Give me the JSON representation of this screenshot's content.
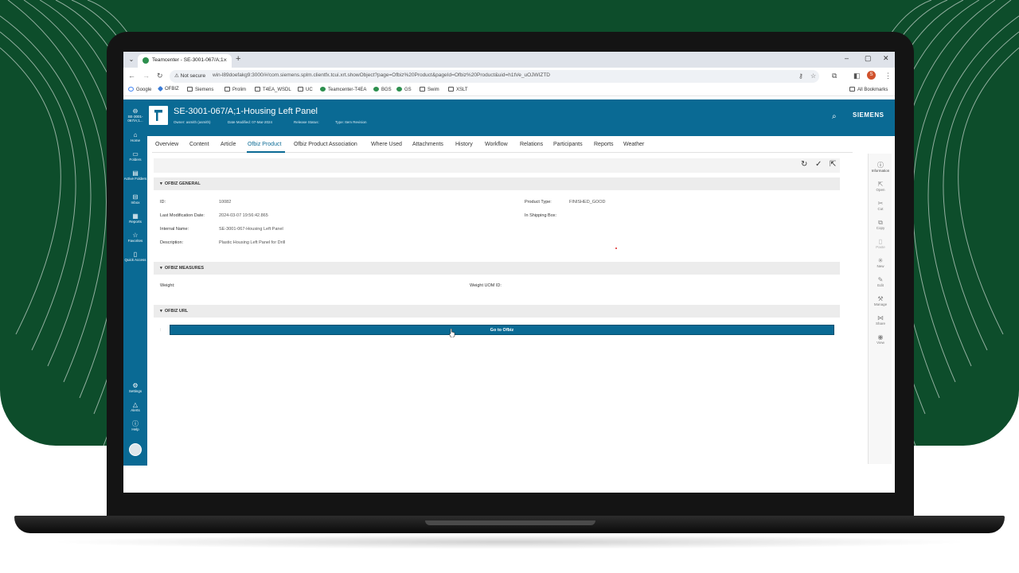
{
  "browser": {
    "tab_title": "Teamcenter - SE-3001-067/A;1",
    "tab_close": "×",
    "new_tab": "+",
    "window_controls": [
      "–",
      "▢",
      "✕"
    ],
    "not_secure": "⚠ Not secure",
    "url": "win-l89doefakg9:3000/#/com.siemens.splm.clientfx.tcui.xrt.showObject?page=Ofbiz%20Product&pageId=Ofbiz%20Product&uid=h1tVe_uOJWIZTD",
    "profile_initial": "S",
    "bookmarks": [
      "Google",
      "OFBIZ",
      "Siemens",
      "Prolim",
      "T4EA_WSDL",
      "UC",
      "Teamcenter-T4EA",
      "BGS",
      "GS",
      "Swim",
      "XSLT"
    ],
    "all_bookmarks": "All Bookmarks"
  },
  "leftnav": {
    "items": [
      {
        "label": "SE-3001-067/A;1...",
        "icon": "back-icon"
      },
      {
        "label": "Home",
        "icon": "home-icon"
      },
      {
        "label": "Folders",
        "icon": "folder-icon"
      },
      {
        "label": "Active Folders",
        "icon": "active-folders-icon"
      },
      {
        "label": "Inbox",
        "icon": "inbox-icon"
      },
      {
        "label": "Reports",
        "icon": "reports-icon"
      },
      {
        "label": "Favorites",
        "icon": "star-icon"
      },
      {
        "label": "Quick Access",
        "icon": "quick-access-icon"
      },
      {
        "label": "Settings",
        "icon": "gear-icon"
      },
      {
        "label": "Alerts",
        "icon": "bell-icon"
      },
      {
        "label": "Help",
        "icon": "help-icon"
      }
    ]
  },
  "header": {
    "title": "SE-3001-067/A;1-Housing Left Panel",
    "owner": "Owner: asmith (asmith)",
    "date_modified": "Date Modified: 07-Mar-2024",
    "release_status": "Release Status:",
    "type": "Type: Item Revision",
    "brand": "SIEMENS"
  },
  "tabs": [
    "Overview",
    "Content",
    "Article",
    "Ofbiz Product",
    "Ofbiz Product Association",
    "Where Used",
    "Attachments",
    "History",
    "Workflow",
    "Relations",
    "Participants",
    "Reports",
    "Weather"
  ],
  "active_tab": "Ofbiz Product",
  "sections": {
    "general": {
      "title": "OFBIZ GENERAL",
      "id_label": "ID:",
      "id_value": "10082",
      "last_mod_label": "Last Modification Date:",
      "last_mod_value": "2024-03-07 19:56:42.865",
      "internal_name_label": "Internal Name:",
      "internal_name_value": "SE-3001-067-Housing Left Panel",
      "description_label": "Description:",
      "description_value": "Plastic Housing Left Panel for Drill",
      "product_type_label": "Product Type:",
      "product_type_value": "FINISHED_GOOD",
      "in_shipping_box_label": "In Shipping Box:"
    },
    "measures": {
      "title": "OFBIZ MEASURES",
      "weight_label": "Weight:",
      "weight_uom_label": "Weight UOM ID:"
    },
    "url": {
      "title": "OFBIZ URL",
      "row_marker": ":",
      "button": "Go to Ofbiz"
    }
  },
  "rightbar": {
    "items": [
      {
        "label": "Information",
        "icon": "info-icon"
      },
      {
        "label": "Open",
        "icon": "open-icon"
      },
      {
        "label": "Cut",
        "icon": "cut-icon"
      },
      {
        "label": "Copy",
        "icon": "copy-icon"
      },
      {
        "label": "Paste",
        "icon": "paste-icon"
      },
      {
        "label": "New",
        "icon": "new-icon"
      },
      {
        "label": "Edit",
        "icon": "edit-icon"
      },
      {
        "label": "Manage",
        "icon": "manage-icon"
      },
      {
        "label": "Share",
        "icon": "share-icon"
      },
      {
        "label": "View",
        "icon": "view-icon"
      }
    ]
  },
  "colors": {
    "background_green": "#0d4d2b",
    "teamcenter_blue": "#0a6a94",
    "section_gray": "#ececec"
  }
}
